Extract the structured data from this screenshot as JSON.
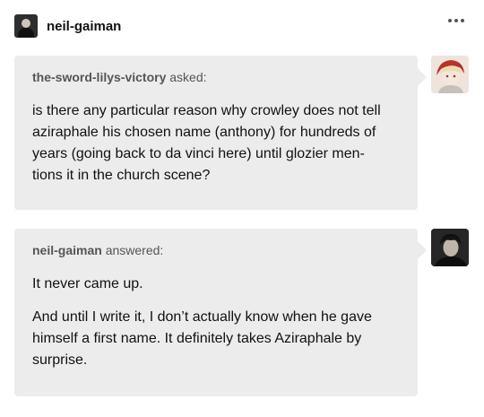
{
  "post": {
    "username": "neil-gaiman",
    "more_icon": "more-horizontal-icon"
  },
  "question": {
    "asker": "the-sword-lilys-victory",
    "verb": "asked:",
    "lines": [
      "is there any particular reason why crowley does not tell",
      "aziraphale his chosen name (anthony) for hundreds of",
      "years (going back to da vinci here) until glozier men-",
      "tions it in the church scene?"
    ]
  },
  "answer": {
    "answerer": "neil-gaiman",
    "verb": "answered:",
    "paragraphs": [
      {
        "lines": [
          "It never came up."
        ]
      },
      {
        "lines": [
          "And until I write it, I don’t actually know when he gave",
          "himself a first name. It definitely takes Aziraphale by",
          "surprise."
        ]
      }
    ]
  },
  "colors": {
    "bubble_bg": "#ececec",
    "text": "#111111",
    "muted": "#555555"
  }
}
